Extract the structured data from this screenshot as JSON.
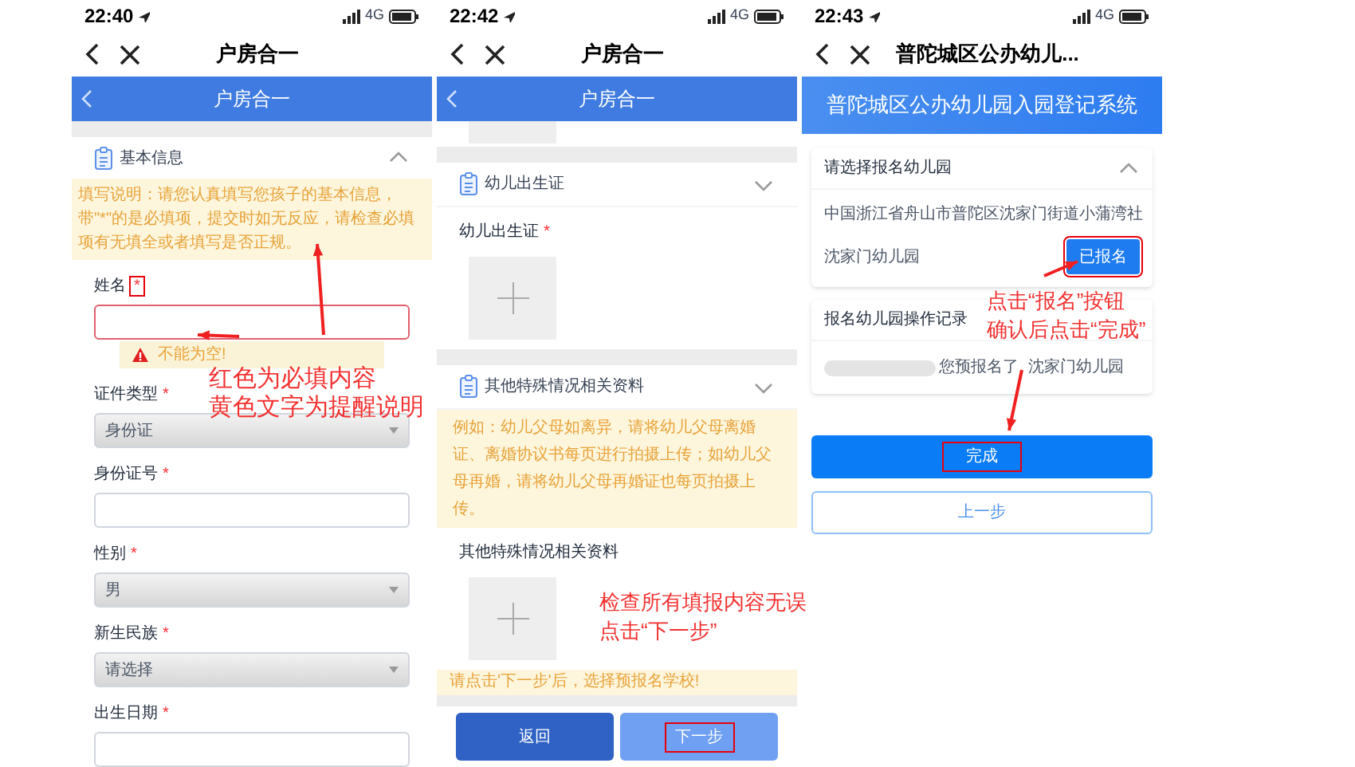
{
  "screens": [
    {
      "kind": "form",
      "status": {
        "time": "22:40",
        "network": "4G"
      },
      "nav_title": "户房合一",
      "header_title": "户房合一",
      "section": {
        "title": "基本信息",
        "expanded": true
      },
      "notice": "填写说明：请您认真填写您孩子的基本信息，带\"*\"的是必填项，提交时如无反应，请检查必填项有无填全或者填写是否正规。",
      "fields": [
        {
          "label": "姓名",
          "mark": "*",
          "kind": "input",
          "mark_highlighted": true,
          "error": "不能为空!"
        },
        {
          "label": "证件类型",
          "mark": "*",
          "kind": "select",
          "value": "身份证",
          "mark_highlighted": false
        },
        {
          "label": "身份证号",
          "mark": "*",
          "kind": "input",
          "mark_highlighted": false
        },
        {
          "label": "性别",
          "mark": "*",
          "kind": "select",
          "value": "男",
          "mark_highlighted": false
        },
        {
          "label": "新生民族",
          "mark": "*",
          "kind": "select",
          "value": "请选择",
          "mark_highlighted": false
        },
        {
          "label": "出生日期",
          "mark": "*",
          "kind": "input",
          "mark_highlighted": false
        }
      ],
      "annotations": [
        "红色为必填内容",
        "黄色文字为提醒说明"
      ]
    },
    {
      "kind": "uploads",
      "status": {
        "time": "22:42",
        "network": "4G"
      },
      "nav_title": "户房合一",
      "header_title": "户房合一",
      "sections": [
        {
          "title": "幼儿出生证",
          "expanded": false,
          "field": {
            "label": "幼儿出生证",
            "mark": "*"
          }
        },
        {
          "title": "其他特殊情况相关资料",
          "expanded": false,
          "notice": "例如：幼儿父母如离异，请将幼儿父母离婚证、离婚协议书每页进行拍摄上传；如幼儿父母再婚，请将幼儿父母再婚证也每页拍摄上传。",
          "field": {
            "label": "其他特殊情况相关资料"
          }
        }
      ],
      "footer_notice": "请点击'下一步'后，选择预报名学校!",
      "buttons": [
        {
          "label": "返回",
          "kind": "secondary",
          "highlighted": false
        },
        {
          "label": "下一步",
          "kind": "primary",
          "highlighted": true
        }
      ],
      "annotations": [
        "检查所有填报内容无误",
        "点击“下一步”"
      ]
    },
    {
      "kind": "registration",
      "status": {
        "time": "22:43",
        "network": "4G"
      },
      "nav_title": "普陀城区公办幼儿...",
      "banner": "普陀城区公办幼儿园入园登记系统",
      "choose_card": {
        "title": "请选择报名幼儿园",
        "expanded": true,
        "address": "中国浙江省舟山市普陀区沈家门街道小蒲湾社",
        "school": "沈家门幼儿园",
        "action": {
          "label": "已报名",
          "highlighted": true
        }
      },
      "record_card": {
        "title": "报名幼儿园操作记录",
        "record": "您预报名了",
        "record_school": "沈家门幼儿园"
      },
      "buttons": [
        {
          "label": "完成",
          "kind": "primary",
          "highlighted": true
        },
        {
          "label": "上一步",
          "kind": "outline",
          "highlighted": false
        }
      ],
      "annotations": [
        "点击“报名”按钮",
        "确认后点击“完成”"
      ]
    }
  ]
}
